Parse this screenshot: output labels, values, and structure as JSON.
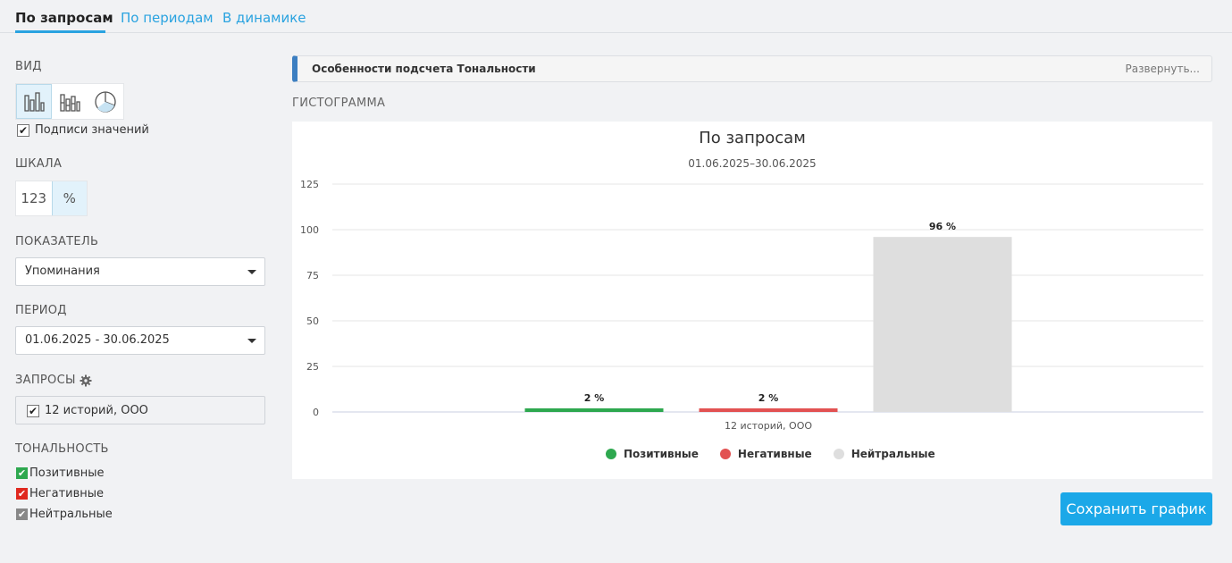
{
  "tabs": [
    {
      "label": "По запросам",
      "active": true
    },
    {
      "label": "По периодам",
      "active": false
    },
    {
      "label": "В динамике",
      "active": false
    }
  ],
  "sidebar": {
    "view_label": "ВИД",
    "view_options": [
      {
        "icon": "bar-chart-icon",
        "active": true
      },
      {
        "icon": "stacked-bar-chart-icon",
        "active": false
      },
      {
        "icon": "pie-chart-icon",
        "active": false
      }
    ],
    "value_labels_checkbox": {
      "label": "Подписи значений",
      "checked": true
    },
    "scale_label": "ШКАЛА",
    "scale_options": [
      {
        "label": "123",
        "active": false
      },
      {
        "label": "%",
        "active": true
      }
    ],
    "metric_label": "ПОКАЗАТЕЛЬ",
    "metric_value": "Упоминания",
    "period_label": "ПЕРИОД",
    "period_value": "01.06.2025 - 30.06.2025",
    "queries_label": "ЗАПРОСЫ",
    "query_item": {
      "label": "12 историй, ООО",
      "checked": true
    },
    "tonality_label": "ТОНАЛЬНОСТЬ",
    "tonality_items": [
      {
        "label": "Позитивные",
        "checked": true,
        "color": "#2ea84f"
      },
      {
        "label": "Негативные",
        "checked": true,
        "color": "#e0291f"
      },
      {
        "label": "Нейтральные",
        "checked": true,
        "color": "#888888"
      }
    ]
  },
  "info_bar": {
    "title": "Особенности подсчета Тональности",
    "expand_label": "Развернуть..."
  },
  "histogram_label": "ГИСТОГРАММА",
  "chart_data": {
    "type": "bar",
    "title": "По запросам",
    "subtitle": "01.06.2025–30.06.2025",
    "categories": [
      "12 историй, ООО"
    ],
    "series": [
      {
        "name": "Позитивные",
        "values": [
          2
        ],
        "label": "2 %",
        "color": "#2ea84f"
      },
      {
        "name": "Негативные",
        "values": [
          2
        ],
        "label": "2 %",
        "color": "#e25252"
      },
      {
        "name": "Нейтральные",
        "values": [
          96
        ],
        "label": "96 %",
        "color": "#dedede"
      }
    ],
    "ylim": [
      0,
      125
    ],
    "yticks": [
      "0",
      "25",
      "50",
      "75",
      "100",
      "125"
    ],
    "grid": true,
    "legend_position": "bottom"
  },
  "save_button": "Сохранить график"
}
